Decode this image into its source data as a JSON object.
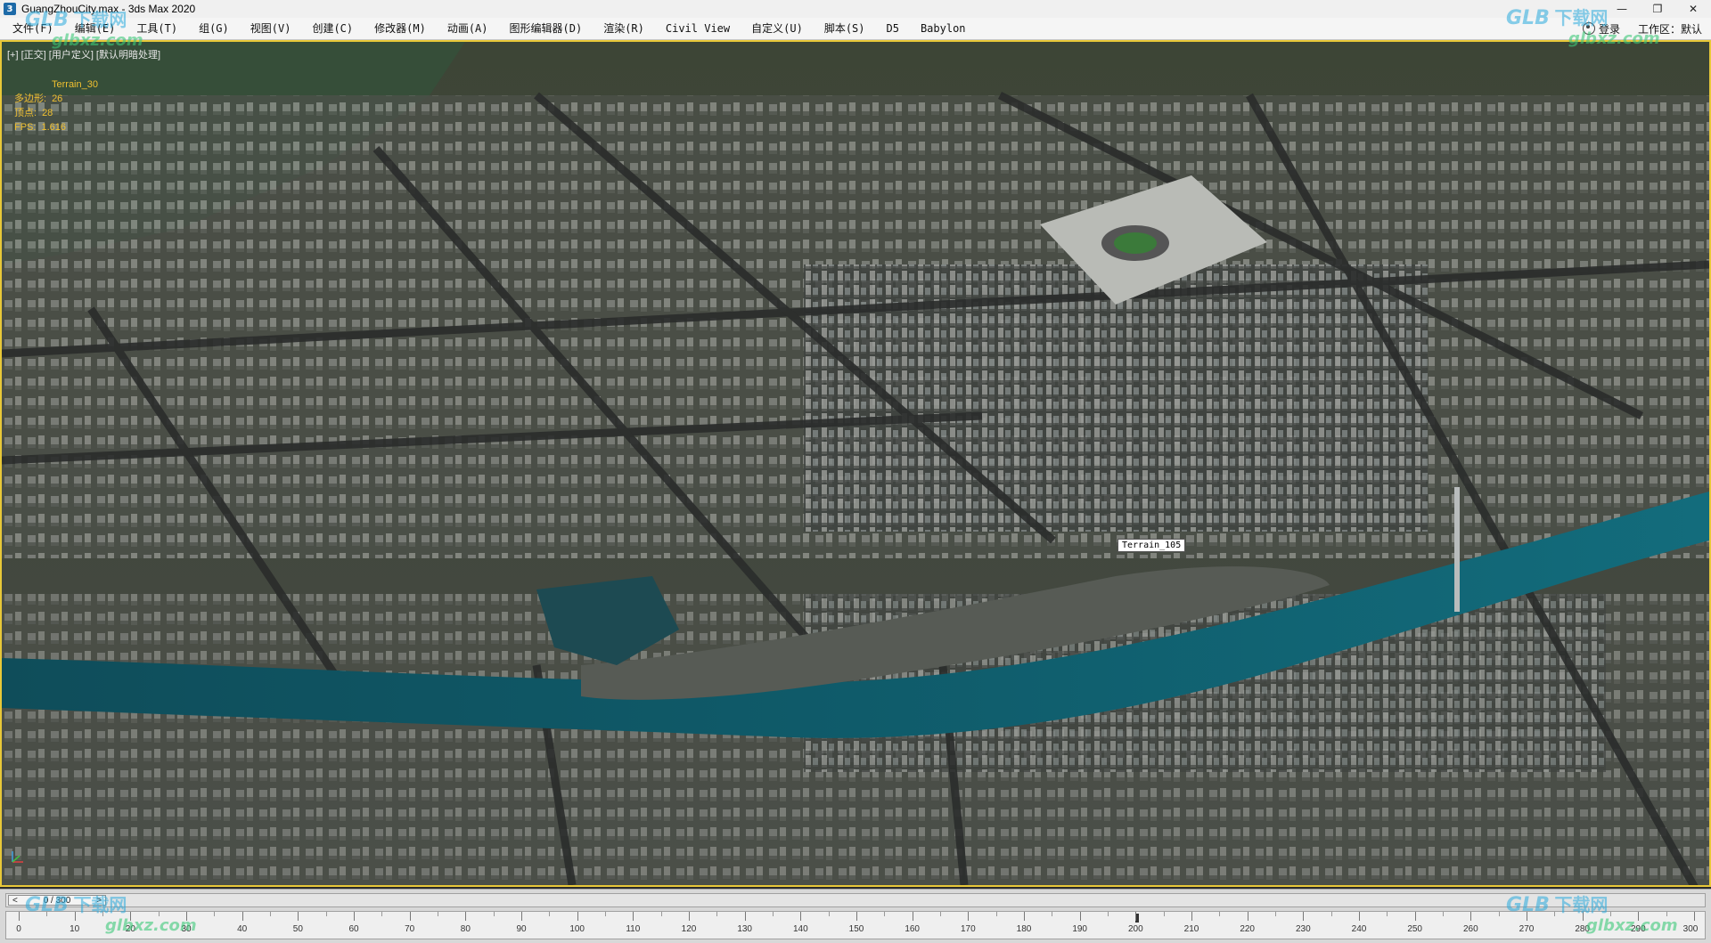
{
  "window": {
    "title": "GuangZhouCity.max - 3ds Max 2020",
    "app_icon_letter": "3",
    "controls": {
      "minimize": "—",
      "maximize": "❐",
      "close": "✕"
    }
  },
  "menu": {
    "items": [
      "文件(F)",
      "编辑(E)",
      "工具(T)",
      "组(G)",
      "视图(V)",
      "创建(C)",
      "修改器(M)",
      "动画(A)",
      "图形编辑器(D)",
      "渲染(R)",
      "Civil View",
      "自定义(U)",
      "脚本(S)",
      "D5",
      "Babylon"
    ],
    "right": {
      "login": "登录",
      "workspace_label": "工作区：",
      "workspace_value": "默认"
    }
  },
  "viewport": {
    "label": "[+] [正交] [用户定义] [默认明暗处理]",
    "stats": [
      {
        "label": "",
        "value": "Terrain_30"
      },
      {
        "label": "多边形:",
        "value": "26"
      },
      {
        "label": "顶点:",
        "value": "28"
      },
      {
        "label": "FPS:",
        "value": "1.616"
      }
    ],
    "tooltip": "Terrain_105",
    "border_color": "#e8c838"
  },
  "timeline": {
    "frame_display": "0 / 300",
    "prev_label": "<",
    "next_label": ">",
    "ticks": [
      10,
      20,
      30,
      40,
      50,
      60,
      70,
      80,
      90,
      100,
      110,
      120,
      130,
      140,
      150,
      160,
      170,
      180,
      190,
      200,
      210,
      220,
      230,
      240,
      250,
      260,
      270,
      280,
      290,
      300
    ],
    "first_tick": "0"
  },
  "watermarks": [
    {
      "brand": "GLB",
      "cn": "下载网",
      "url": "glbxz.com"
    },
    {
      "brand": "GLB",
      "cn": "下载网",
      "url": "glbxz.com"
    },
    {
      "brand": "GLB",
      "cn": "下载网",
      "url": "glbxz.com"
    },
    {
      "brand": "GLB",
      "cn": "下载网",
      "url": "glbxz.com"
    }
  ]
}
